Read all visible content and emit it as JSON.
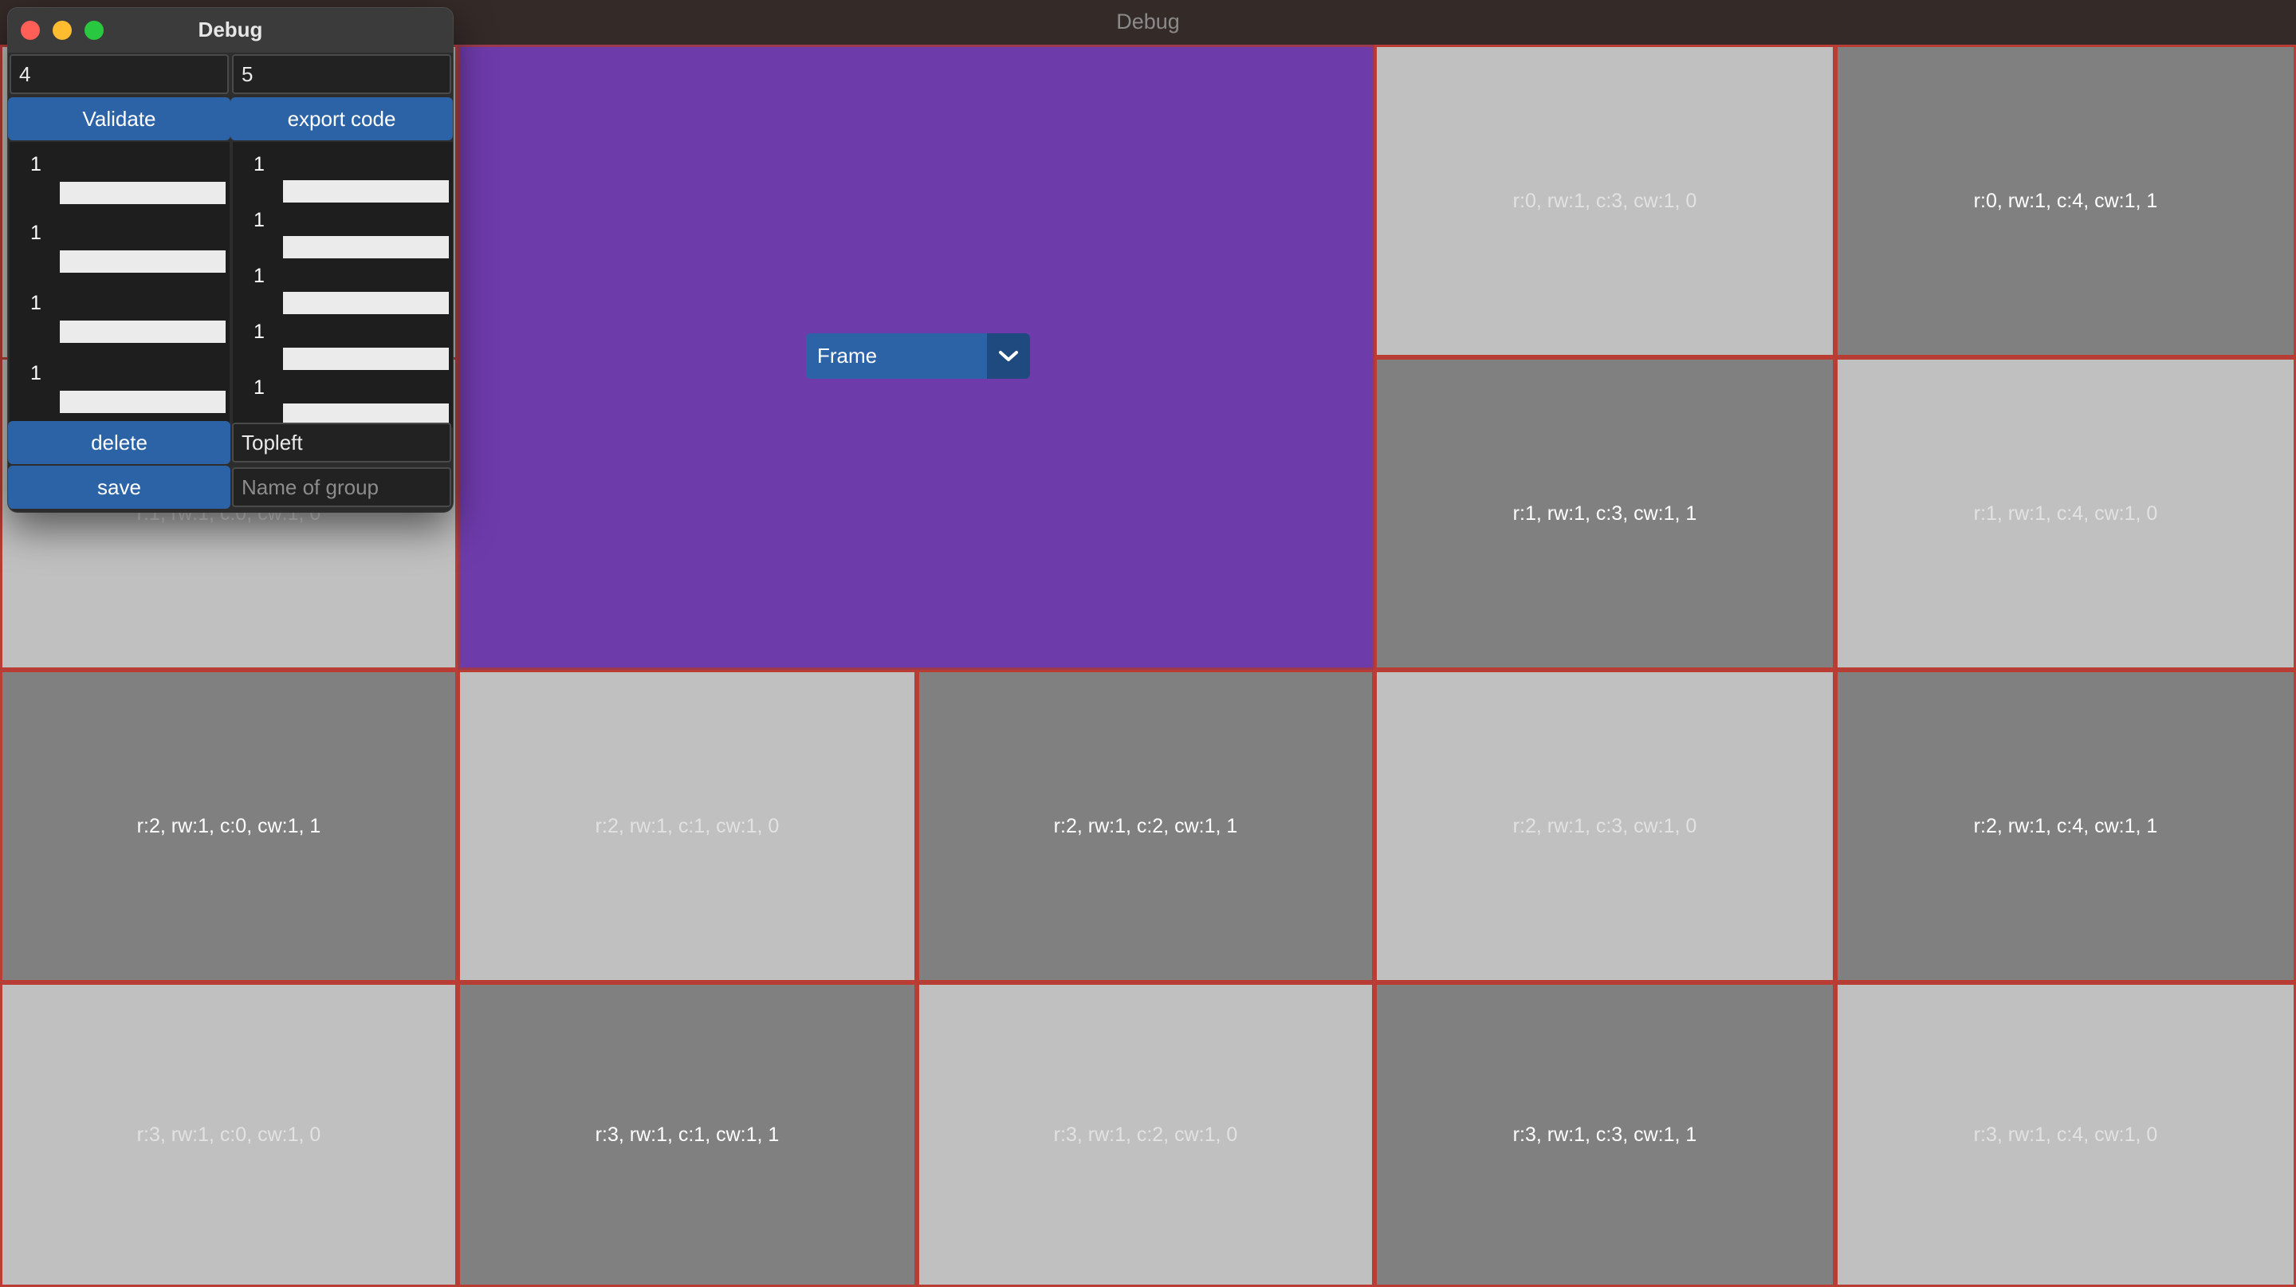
{
  "main_window": {
    "title": "Debug"
  },
  "grid": {
    "cells": {
      "r0c3": "r:0, rw:1, c:3, cw:1, 0",
      "r0c4": "r:0, rw:1, c:4, cw:1, 1",
      "r1c0": "r:1, rw:1, c:0, cw:1, 0",
      "r1c3": "r:1, rw:1, c:3, cw:1, 1",
      "r1c4": "r:1, rw:1, c:4, cw:1, 0",
      "r2c0": "r:2, rw:1, c:0, cw:1, 1",
      "r2c1": "r:2, rw:1, c:1, cw:1, 0",
      "r2c2": "r:2, rw:1, c:2, cw:1, 1",
      "r2c3": "r:2, rw:1, c:3, cw:1, 0",
      "r2c4": "r:2, rw:1, c:4, cw:1, 1",
      "r3c0": "r:3, rw:1, c:0, cw:1, 0",
      "r3c1": "r:3, rw:1, c:1, cw:1, 1",
      "r3c2": "r:3, rw:1, c:2, cw:1, 0",
      "r3c3": "r:3, rw:1, c:3, cw:1, 1",
      "r3c4": "r:3, rw:1, c:4, cw:1, 0"
    },
    "frame_select": {
      "value": "Frame"
    }
  },
  "debug_window": {
    "title": "Debug",
    "rows_input": "4",
    "cols_input": "5",
    "validate_label": "Validate",
    "export_label": "export code",
    "row_weights": [
      "1",
      "1",
      "1",
      "1"
    ],
    "col_weights": [
      "1",
      "1",
      "1",
      "1",
      "1"
    ],
    "delete_label": "delete",
    "save_label": "save",
    "anchor_input": "Topleft",
    "group_name_placeholder": "Name of group"
  },
  "colors": {
    "accent_button": "#2c63a6",
    "frame_purple": "#6e3bab",
    "cell_border": "#b83d35",
    "cell_light": "#c0c0c0",
    "cell_dark": "#808080"
  },
  "icons": {
    "dropdown": "chevron-down-icon"
  }
}
